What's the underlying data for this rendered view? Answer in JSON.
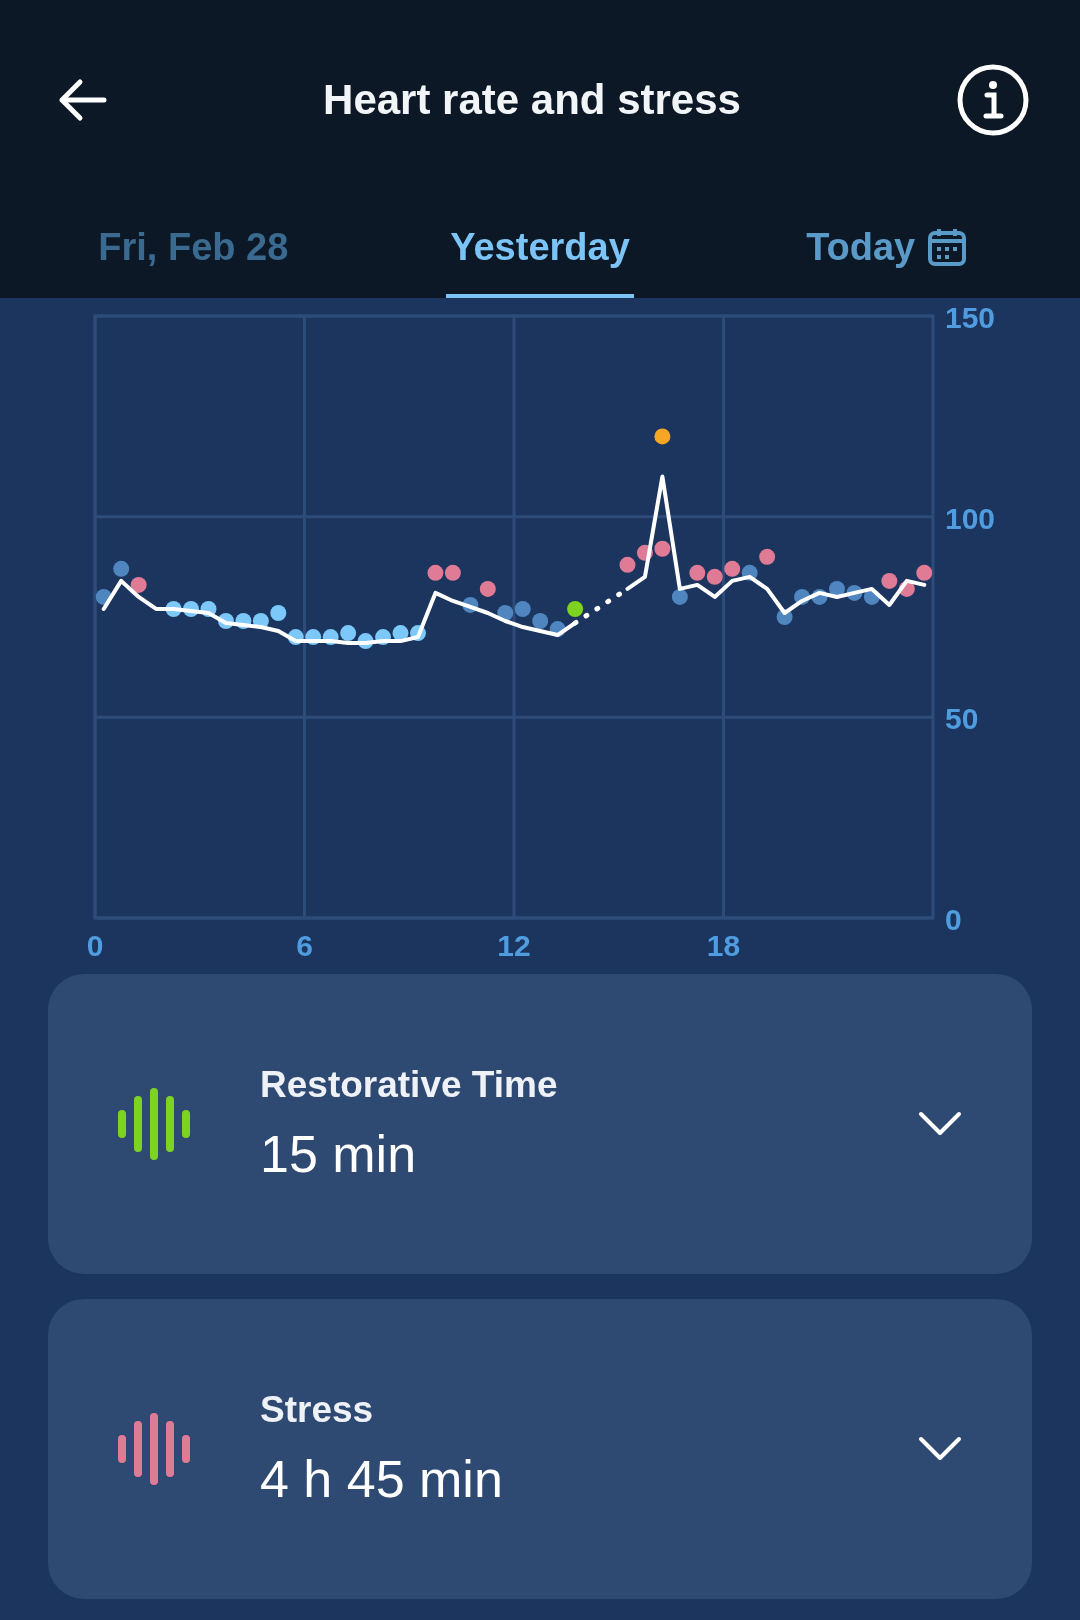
{
  "header": {
    "title": "Heart rate and stress"
  },
  "tabs": [
    {
      "label": "Fri, Feb 28",
      "selected": false,
      "faded": true,
      "calendar": false
    },
    {
      "label": "Yesterday",
      "selected": true,
      "faded": false,
      "calendar": false
    },
    {
      "label": "Today",
      "selected": false,
      "faded": false,
      "calendar": true
    }
  ],
  "chart_data": {
    "type": "scatter",
    "x": [
      0.25,
      0.75,
      1.25,
      1.75,
      2.25,
      2.75,
      3.25,
      3.75,
      4.25,
      4.75,
      5.25,
      5.75,
      6.25,
      6.75,
      7.25,
      7.75,
      8.25,
      8.75,
      9.25,
      9.75,
      10.25,
      10.75,
      11.25,
      11.75,
      12.25,
      12.75,
      13.25,
      13.75,
      14.25,
      14.75,
      15.25,
      15.75,
      16.25,
      16.75,
      17.25,
      17.75,
      18.25,
      18.75,
      19.25,
      19.75,
      20.25,
      20.75,
      21.25,
      21.75,
      22.25,
      22.75,
      23.25,
      23.75
    ],
    "grid": true,
    "xlim": [
      0,
      24
    ],
    "ylim": [
      0,
      150
    ],
    "xticks": [
      0,
      6,
      12,
      18
    ],
    "yticks": [
      0,
      50,
      100,
      150
    ],
    "series": [
      {
        "color": "#4f86bf",
        "values": [
          80,
          87,
          null,
          null,
          null,
          null,
          null,
          null,
          null,
          null,
          null,
          null,
          null,
          null,
          null,
          null,
          null,
          null,
          null,
          null,
          null,
          78,
          null,
          76,
          77,
          74,
          72,
          null,
          null,
          null,
          null,
          null,
          null,
          80,
          null,
          null,
          null,
          86,
          null,
          75,
          80,
          80,
          82,
          81,
          80,
          null,
          null,
          null
        ]
      },
      {
        "color": "#7cc8f8",
        "values": [
          null,
          null,
          null,
          null,
          77,
          77,
          77,
          74,
          74,
          74,
          76,
          70,
          70,
          70,
          71,
          69,
          70,
          71,
          71,
          null,
          null,
          null,
          null,
          null,
          null,
          null,
          null,
          null,
          null,
          null,
          null,
          null,
          null,
          null,
          null,
          null,
          null,
          null,
          null,
          null,
          null,
          null,
          null,
          null,
          null,
          null,
          null,
          null
        ]
      },
      {
        "color": "#e07b95",
        "values": [
          null,
          null,
          83,
          null,
          null,
          null,
          null,
          null,
          null,
          null,
          null,
          null,
          null,
          null,
          null,
          null,
          null,
          null,
          null,
          86,
          86,
          null,
          82,
          null,
          null,
          null,
          null,
          null,
          null,
          null,
          88,
          91,
          92,
          null,
          86,
          85,
          87,
          null,
          90,
          null,
          null,
          null,
          null,
          null,
          null,
          84,
          82,
          86
        ]
      },
      {
        "color": "#7ed321",
        "values": [
          null,
          null,
          null,
          null,
          null,
          null,
          null,
          null,
          null,
          null,
          null,
          null,
          null,
          null,
          null,
          null,
          null,
          null,
          null,
          null,
          null,
          null,
          null,
          null,
          null,
          null,
          null,
          77,
          null,
          null,
          null,
          null,
          null,
          null,
          null,
          null,
          null,
          null,
          null,
          null,
          null,
          null,
          null,
          null,
          null,
          null,
          null,
          null
        ]
      },
      {
        "color": "#f5a623",
        "values": [
          null,
          null,
          null,
          null,
          null,
          null,
          null,
          null,
          null,
          null,
          null,
          null,
          null,
          null,
          null,
          null,
          null,
          null,
          null,
          null,
          null,
          null,
          null,
          null,
          null,
          null,
          null,
          null,
          null,
          null,
          null,
          null,
          120,
          null,
          null,
          null,
          null,
          null,
          null,
          null,
          null,
          null,
          null,
          null,
          null,
          null,
          null,
          null
        ]
      },
      {
        "type": "line",
        "color": "#ffffff",
        "values": [
          77,
          84,
          80,
          77,
          77,
          76.5,
          76,
          73.5,
          73,
          72.5,
          71.5,
          69,
          69,
          69,
          68.5,
          68.5,
          69,
          69,
          70,
          81,
          79,
          77.5,
          76,
          74,
          72.5,
          71.5,
          70.5,
          73.5,
          null,
          null,
          82,
          85,
          110,
          82,
          83,
          80,
          84,
          85,
          82,
          76,
          79,
          81,
          80,
          81,
          82,
          78,
          84,
          83
        ]
      }
    ]
  },
  "cards": [
    {
      "title": "Restorative Time",
      "value": "15 min",
      "color": "#7ed321",
      "expanded": false
    },
    {
      "title": "Stress",
      "value": "4 h 45 min",
      "color": "#e07b95",
      "expanded": false
    }
  ]
}
